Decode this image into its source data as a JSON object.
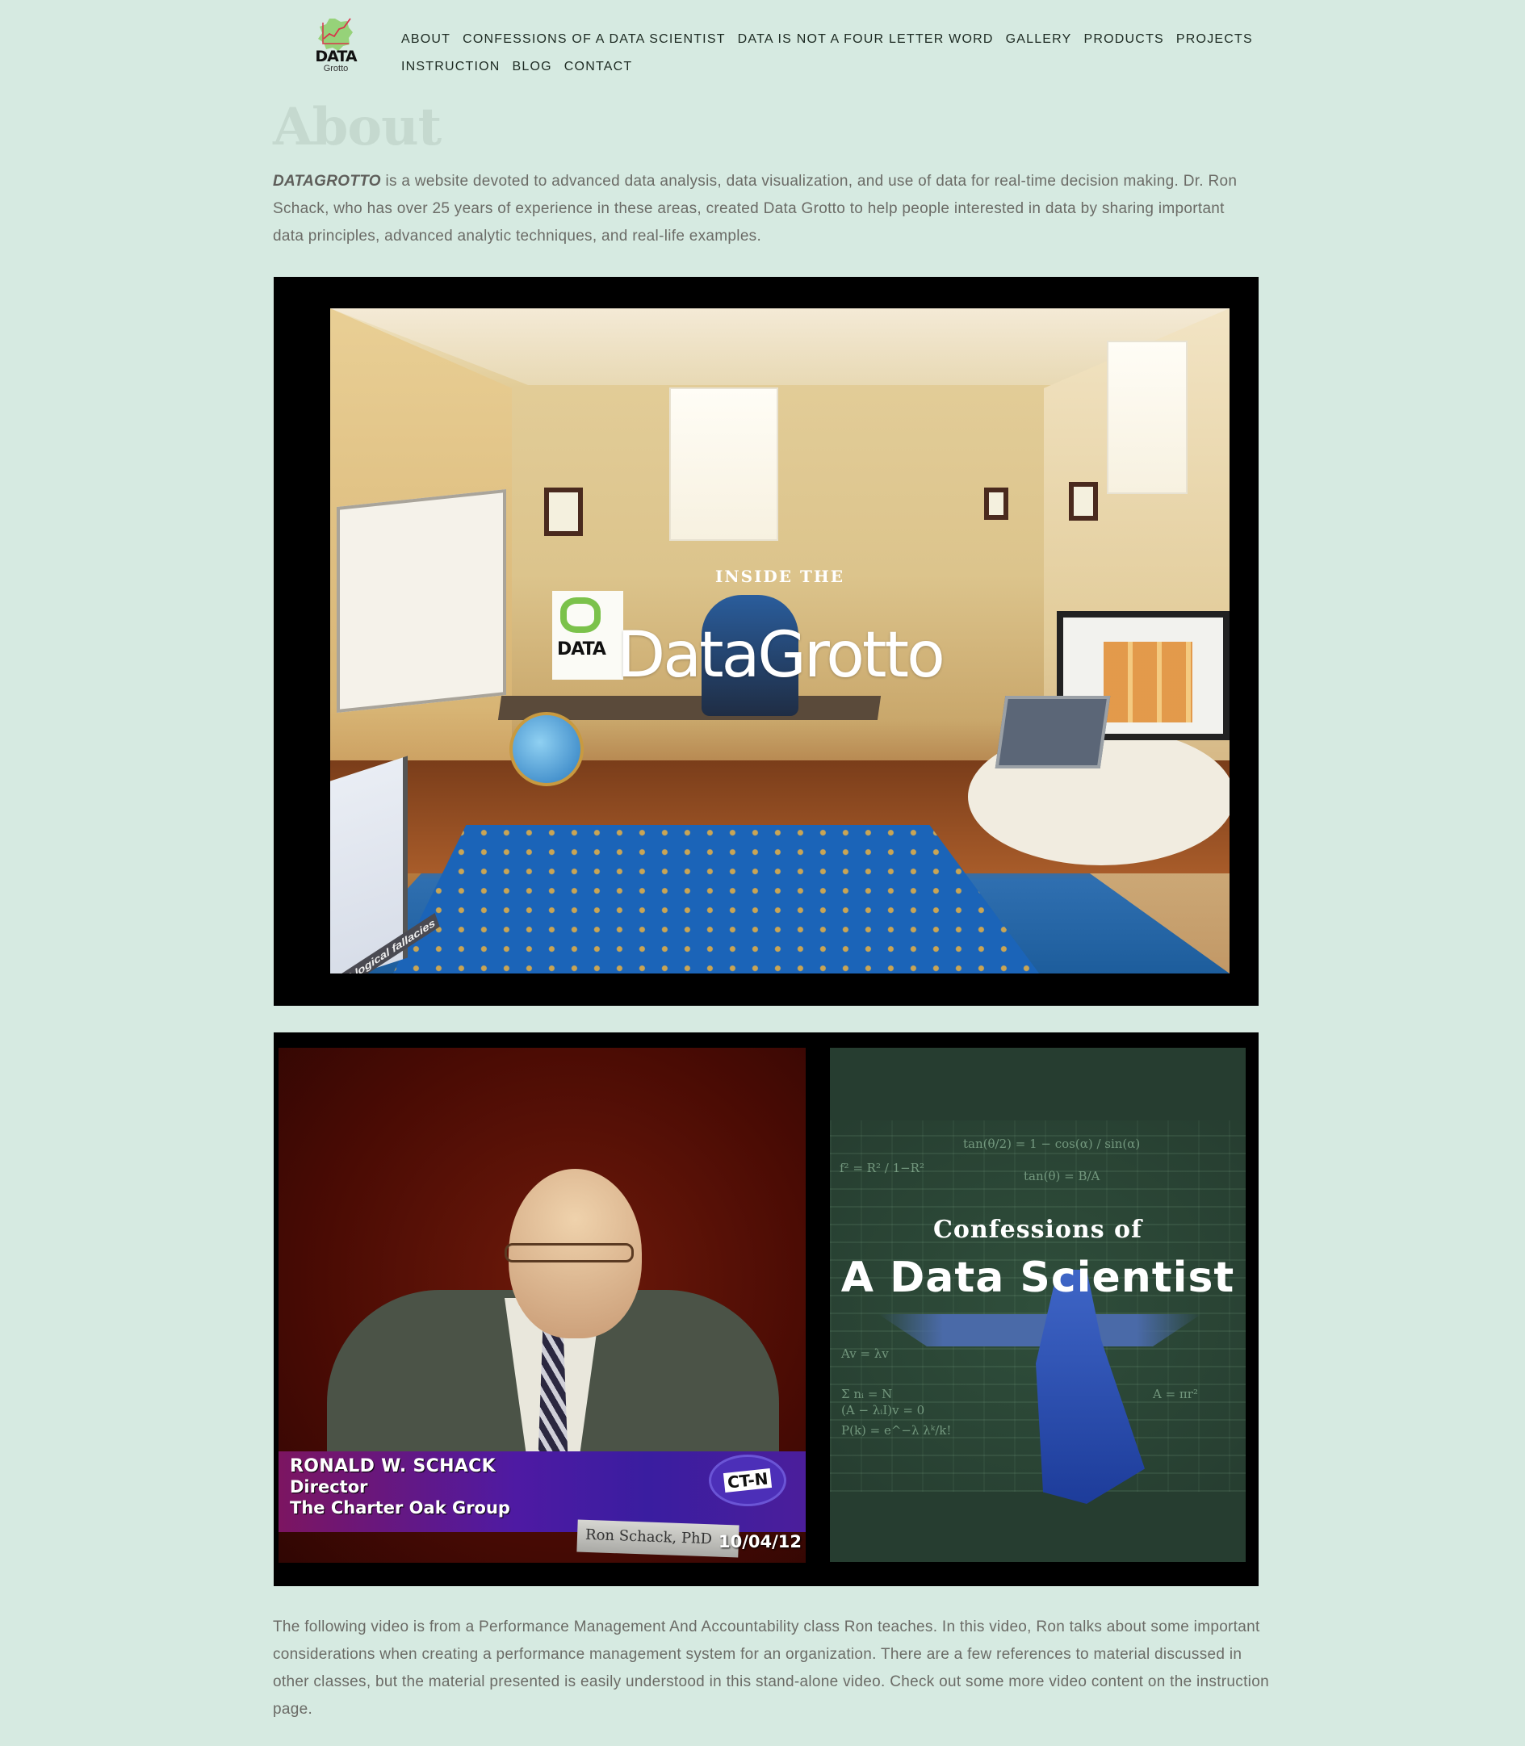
{
  "site": {
    "logo_word": "DATA",
    "logo_sub": "Grotto",
    "colors": {
      "background": "#d6eae1",
      "nav_text": "#1d2a22",
      "title": "#c5d9cf",
      "body_text": "#6b6b66",
      "frame": "#000000"
    }
  },
  "nav": {
    "row1": [
      "About",
      "Confessions of a Data Scientist",
      "Data is not a four letter word",
      "Gallery",
      "Products",
      "Projects"
    ],
    "row2": [
      "Instruction",
      "Blog",
      "Contact"
    ]
  },
  "page": {
    "title": "About",
    "intro_lead": "DATAGROTTO",
    "intro_rest": " is a website devoted to advanced data analysis, data visualization, and use of data for real-time decision making. Dr. Ron Schack, who has over 25 years of experience in these areas, created Data Grotto to help people interested in data by sharing important data principles, advanced analytic techniques, and real-life examples."
  },
  "hero": {
    "kicker": "INSIDE THE",
    "title": "DataGrotto",
    "poster_logo": "DATA",
    "poster_text": "mit logical fallacies"
  },
  "video_thumb": {
    "name": "RONALD W. SCHACK",
    "role": "Director",
    "org": "The Charter Oak Group",
    "network": "CT-N",
    "nameplate": "Ron Schack, PhD",
    "date": "10/04/12"
  },
  "cover": {
    "kicker": "Confessions of",
    "title": "A Data Scientist",
    "equations": [
      "tan(θ/2) = 1 − cos(α) / sin(α)",
      "f² = R² / 1−R²",
      "tan(θ) = B/A",
      "Av = λv",
      "Σ nᵢ = N",
      "P(k) = e^−λ λᵏ/k!",
      "A = πr²",
      "(A − λᵢI)v = 0"
    ]
  },
  "outro": "The following video is from a Performance Management And Accountability class Ron teaches.  In this video, Ron talks about some important considerations when creating a performance management system for an organization.  There are a few references to material discussed in other classes, but the material presented is easily understood in this stand-alone video.  Check out some more video content on the instruction page."
}
